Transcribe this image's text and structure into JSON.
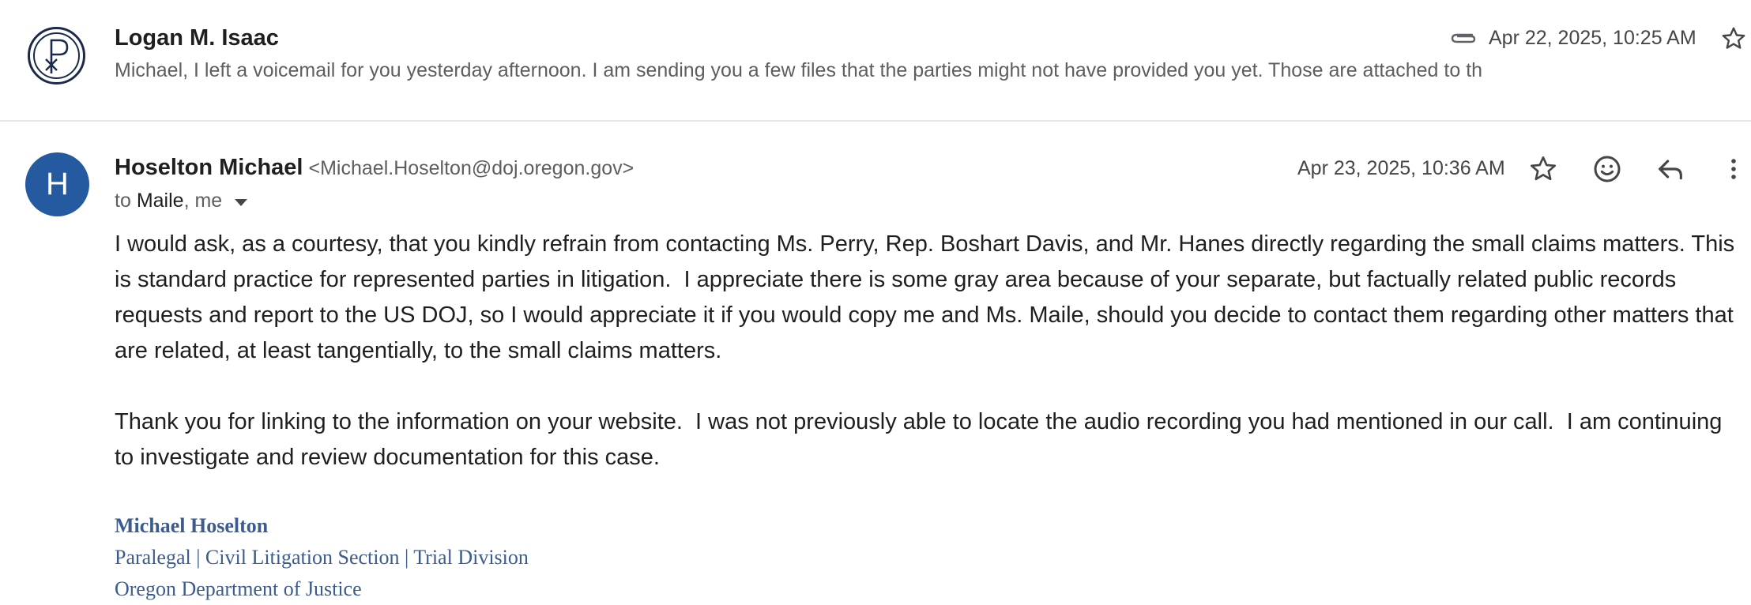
{
  "thread": {
    "collapsed_message": {
      "sender": "Logan M. Isaac",
      "snippet": "Michael, I left a voicemail for you yesterday afternoon. I am sending you a few files that the parties might not have provided you yet. Those are attached to th",
      "date": "Apr 22, 2025, 10:25 AM",
      "has_attachment": true,
      "avatar_icon": "chi-rho-emblem-icon"
    },
    "expanded_message": {
      "avatar_letter": "H",
      "avatar_color": "#255aa0",
      "sender_name": "Hoselton Michael",
      "sender_email": "<Michael.Hoselton@doj.oregon.gov>",
      "to_prefix": "to",
      "to_recipients": "Maile",
      "to_rest": ", me",
      "date": "Apr 23, 2025, 10:36 AM",
      "body_paragraphs": [
        "I would ask, as a courtesy, that you kindly refrain from contacting Ms. Perry, Rep. Boshart Davis, and Mr. Hanes directly regarding the small claims matters. This is standard practice for represented parties in litigation.  I appreciate there is some gray area because of your separate, but factually related public records requests and report to the US DOJ, so I would appreciate it if you would copy me and Ms. Maile, should you decide to contact them regarding other matters that are related, at least tangentially, to the small claims matters.",
        "Thank you for linking to the information on your website.  I was not previously able to locate the audio recording you had mentioned in our call.  I am continuing to investigate and review documentation for this case."
      ],
      "signature": {
        "name": "Michael Hoselton",
        "title": "Paralegal | Civil Litigation Section | Trial Division",
        "org": "Oregon Department of Justice",
        "color": "#3c5b8f"
      }
    }
  }
}
